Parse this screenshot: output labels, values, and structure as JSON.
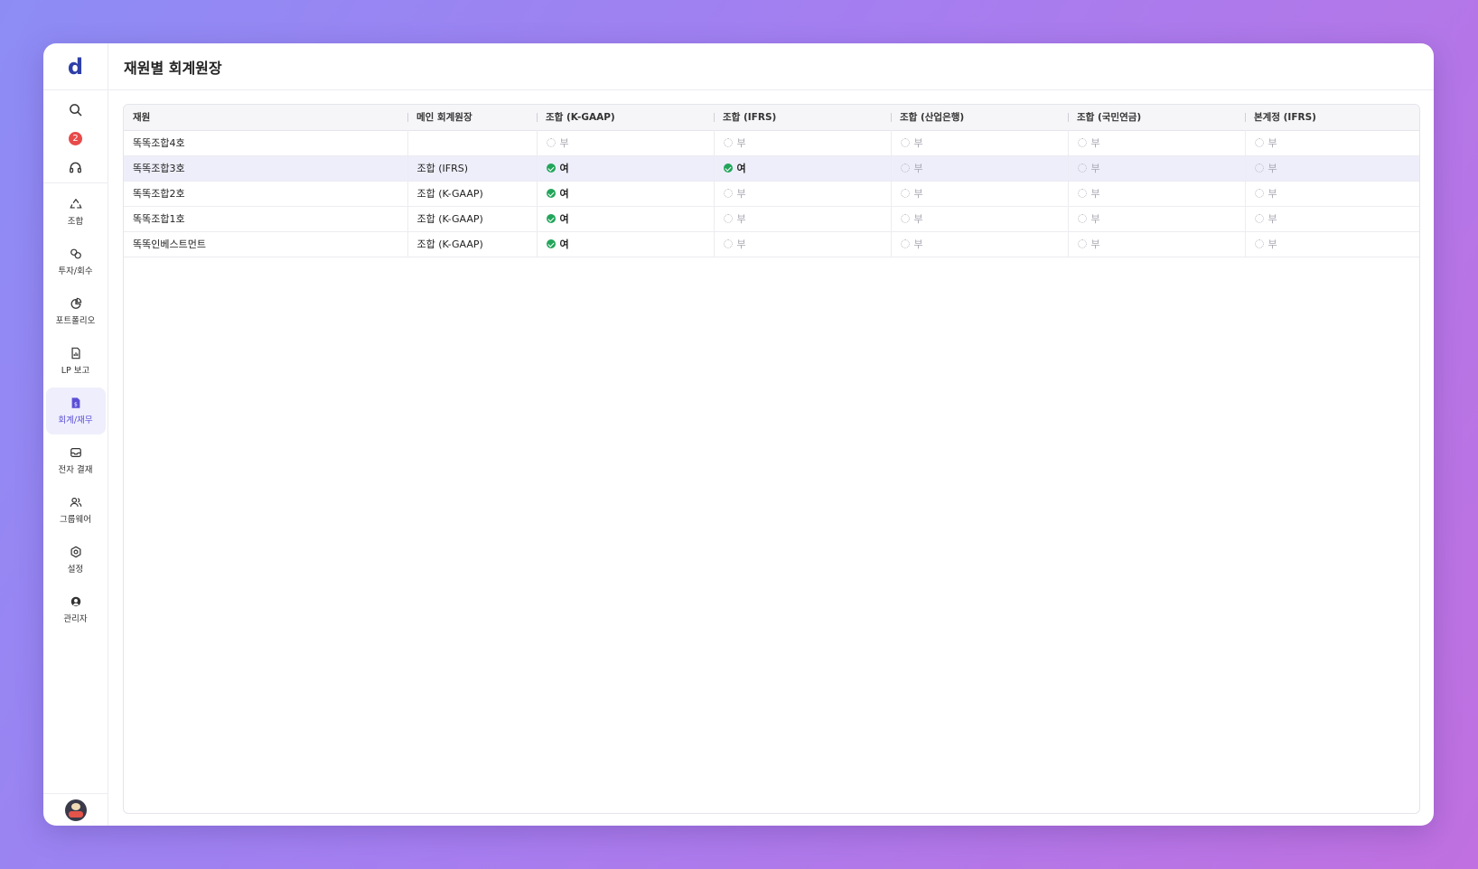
{
  "app": {
    "logo": "d"
  },
  "header": {
    "title": "재원별 회계원장"
  },
  "sidebar": {
    "notification_count": "2",
    "items": [
      {
        "key": "fund",
        "label": "조합",
        "icon": "recycle-icon",
        "active": false
      },
      {
        "key": "invest",
        "label": "투자/회수",
        "icon": "coins-icon",
        "active": false
      },
      {
        "key": "portfolio",
        "label": "포트폴리오",
        "icon": "pie-chart-icon",
        "active": false
      },
      {
        "key": "lp",
        "label": "LP 보고",
        "icon": "report-file-icon",
        "active": false
      },
      {
        "key": "accounting",
        "label": "회계/재무",
        "icon": "dollar-file-icon",
        "active": true
      },
      {
        "key": "approval",
        "label": "전자 결재",
        "icon": "inbox-icon",
        "active": false
      },
      {
        "key": "groupware",
        "label": "그룹웨어",
        "icon": "users-icon",
        "active": false
      },
      {
        "key": "settings",
        "label": "설정",
        "icon": "gear-icon",
        "active": false
      },
      {
        "key": "admin",
        "label": "관리자",
        "icon": "admin-headset-icon",
        "active": false
      }
    ]
  },
  "table": {
    "columns": [
      "재원",
      "메인 회계원장",
      "조합 (K-GAAP)",
      "조합 (IFRS)",
      "조합 (산업은행)",
      "조합 (국민연금)",
      "본계정 (IFRS)"
    ],
    "yes_label": "여",
    "no_label": "부",
    "rows": [
      {
        "name": "똑똑조합4호",
        "main": "",
        "flags": [
          false,
          false,
          false,
          false,
          false
        ],
        "selected": false
      },
      {
        "name": "똑똑조합3호",
        "main": "조합 (IFRS)",
        "flags": [
          true,
          true,
          false,
          false,
          false
        ],
        "selected": true
      },
      {
        "name": "똑똑조합2호",
        "main": "조합 (K-GAAP)",
        "flags": [
          true,
          false,
          false,
          false,
          false
        ],
        "selected": false
      },
      {
        "name": "똑똑조합1호",
        "main": "조합 (K-GAAP)",
        "flags": [
          true,
          false,
          false,
          false,
          false
        ],
        "selected": false
      },
      {
        "name": "똑똑인베스트먼트",
        "main": "조합 (K-GAAP)",
        "flags": [
          true,
          false,
          false,
          false,
          false
        ],
        "selected": false
      }
    ]
  },
  "colors": {
    "accent": "#5a4fd6",
    "yes": "#22a55a",
    "badge": "#e84a4a"
  }
}
